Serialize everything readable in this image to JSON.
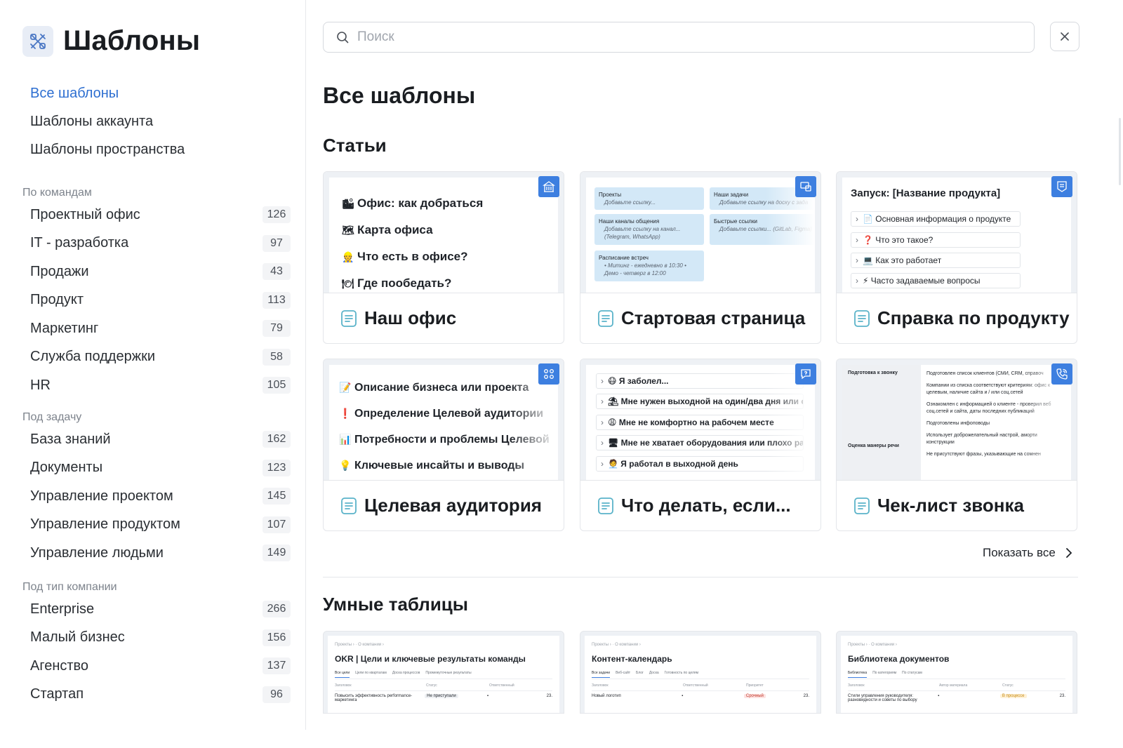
{
  "colors": {
    "accent": "#2e6fd1",
    "badge": "#3d7fe0",
    "preview_bg": "#eef1f5"
  },
  "brand": {
    "title": "Шаблоны",
    "icon": "templates-icon"
  },
  "nav": {
    "all": "Все шаблоны",
    "account": "Шаблоны аккаунта",
    "space": "Шаблоны пространства"
  },
  "groups": [
    {
      "title": "По командам",
      "items": [
        {
          "label": "Проектный офис",
          "count": "126"
        },
        {
          "label": "IT - разработка",
          "count": "97"
        },
        {
          "label": "Продажи",
          "count": "43"
        },
        {
          "label": "Продукт",
          "count": "113"
        },
        {
          "label": "Маркетинг",
          "count": "79"
        },
        {
          "label": "Служба поддержки",
          "count": "58"
        },
        {
          "label": "HR",
          "count": "105"
        }
      ]
    },
    {
      "title": "Под задачу",
      "items": [
        {
          "label": "База знаний",
          "count": "162"
        },
        {
          "label": "Документы",
          "count": "123"
        },
        {
          "label": "Управление проектом",
          "count": "145"
        },
        {
          "label": "Управление продуктом",
          "count": "107"
        },
        {
          "label": "Управление людьми",
          "count": "149"
        }
      ]
    },
    {
      "title": "Под тип компании",
      "items": [
        {
          "label": "Enterprise",
          "count": "266"
        },
        {
          "label": "Малый бизнес",
          "count": "156"
        },
        {
          "label": "Агенство",
          "count": "137"
        },
        {
          "label": "Стартап",
          "count": "96"
        }
      ]
    }
  ],
  "search": {
    "placeholder": "Поиск",
    "value": ""
  },
  "main": {
    "title": "Все шаблоны",
    "articles_title": "Статьи",
    "tables_title": "Умные таблицы",
    "show_all": "Показать все"
  },
  "cards": [
    {
      "title": "Наш офис",
      "badge_icon": "office-building-icon",
      "preview": [
        "Офис: как добраться",
        "Карта офиса",
        "Что есть в офисе?",
        "Где пообедать?"
      ],
      "emoji": [
        "🏙",
        "🗺",
        "👷",
        "🍽"
      ]
    },
    {
      "title": "Стартовая страница",
      "badge_icon": "screens-icon",
      "tiles": [
        {
          "head": "Проекты",
          "sub": "Добавьте ссылку..."
        },
        {
          "head": "Наши задачи",
          "sub": "Добавьте ссылку на доску с зада"
        },
        {
          "head": "Наши каналы общения",
          "sub": "Добавьте ссылку на канал... (Telegram, WhatsApp)"
        },
        {
          "head": "Быстрые ссылки",
          "sub": "Добавьте ссылки... (GitLab, Figma)"
        },
        {
          "head": "Расписание встреч",
          "sub": "• Митинг - ежедневно в 10:30 • Демо - четверг в 12:00"
        }
      ]
    },
    {
      "title": "Справка по продукту",
      "badge_icon": "shield-doc-icon",
      "doc_title": "Запуск: [Название продукта]",
      "toggles": [
        "📄 Основная информация о продукте",
        "❓ Что это такое?",
        "💻 Как это работает",
        "⚡ Часто задаваемые вопросы"
      ]
    },
    {
      "title": "Целевая аудитория",
      "badge_icon": "audience-icon",
      "preview": [
        "Описание бизнеса или проекта",
        "Определение Целевой аудитории",
        "Потребности и проблемы Целевой",
        "Ключевые инсайты и выводы"
      ],
      "emoji": [
        "📝",
        "❗",
        "📊",
        "💡"
      ]
    },
    {
      "title": "Что делать, если...",
      "badge_icon": "chat-question-icon",
      "toggles": [
        "😷 Я заболел...",
        "⛱ Мне нужен выходной на один/два дня или о",
        "😩 Мне не комфортно на рабочем месте",
        "🖥 Мне не хватает оборудования или плохо ра",
        "🧑‍💼 Я работал в выходной день"
      ]
    },
    {
      "title": "Чек-лист звонка",
      "badge_icon": "phone-icon",
      "rows_left": [
        "Подготовка к звонку",
        "Оценка манеры речи"
      ],
      "rows_right": [
        "Подготовлен список клиентов (СМИ, CRM, справоч",
        "Компании из списка соответствуют критериям: офис к целевым, наличие сайта и / или соц.сетей",
        "Ознакомлен с информацией о клиенте - проверил веб соц.сетей и сайта, даты последних публикаций",
        "Подготовлены инфоповоды",
        "Использует доброжелательный настрой, аморти конструкции",
        "Не присутствуют фразы, указывающие на сомнен"
      ]
    }
  ],
  "tables": [
    {
      "crumbs": "Проекты  ›  ·  О компании  ›",
      "title": "OKR | Цели и ключевые результаты команды",
      "tabs": [
        "Все цели",
        "Цели по кварталам",
        "Доска процессов",
        "Промежуточные результаты"
      ],
      "headers": [
        "Заголовок",
        "Статус",
        "Ответственный",
        ""
      ],
      "row": [
        "Повысить эффективность performance-маркетинга",
        "Не приступали",
        "",
        "23."
      ]
    },
    {
      "crumbs": "Проекты  ›  ·  О компании  ›",
      "title": "Контент-календарь",
      "tabs": [
        "Все задачи",
        "Веб-сайт",
        "Блог",
        "Доска",
        "Готовность по целям"
      ],
      "headers": [
        "Заголовок",
        "Ответственный",
        "Приоритет",
        ""
      ],
      "row": [
        "Новый логотип",
        "",
        "Срочный",
        "23."
      ]
    },
    {
      "crumbs": "Проекты  ›  ·  О компании  ›",
      "title": "Библиотека документов",
      "tabs": [
        "Библиотека",
        "По категориям",
        "По статусам"
      ],
      "headers": [
        "Заголовок",
        "Автор материала",
        "Статус",
        ""
      ],
      "row": [
        "Стили управления руководителя: разновидности и советы по выбору",
        "",
        "В процессе",
        "23."
      ]
    }
  ]
}
